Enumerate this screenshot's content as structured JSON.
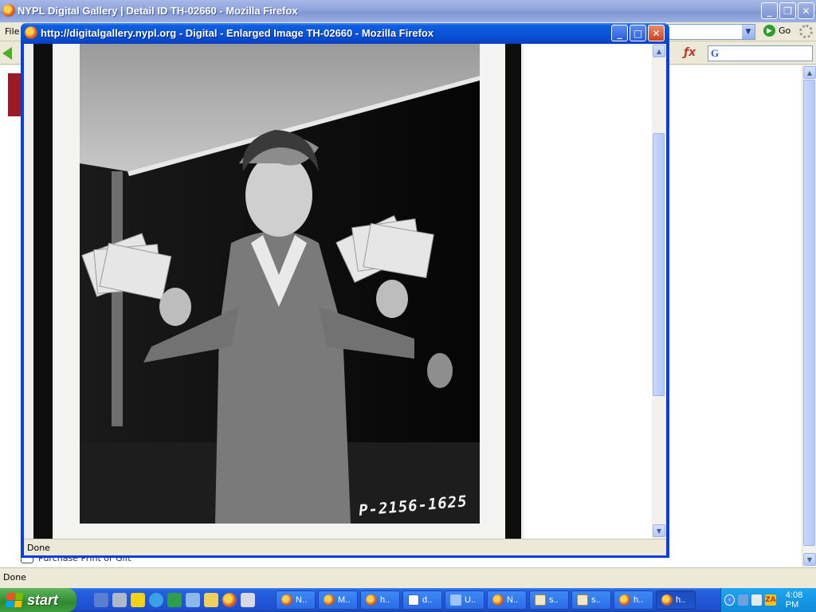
{
  "background_window": {
    "title": "NYPL Digital Gallery | Detail ID TH-02660 - Mozilla Firefox",
    "menu_file": "File",
    "go_label": "Go",
    "purchase_link": "Purchase Print or Gift",
    "status": "Done"
  },
  "popup_window": {
    "title": "http://digitalgallery.nypl.org - Digital - Enlarged Image TH-02660 - Mozilla Firefox",
    "photo_annotation": "P-2156-1625",
    "status": "Done"
  },
  "taskbar": {
    "start_label": "start",
    "tasks": [
      {
        "label": "N..",
        "icon": "firefox-icon"
      },
      {
        "label": "M..",
        "icon": "firefox-icon"
      },
      {
        "label": "h..",
        "icon": "firefox-icon"
      },
      {
        "label": "d..",
        "icon": "word-icon"
      },
      {
        "label": "U..",
        "icon": "document-icon"
      },
      {
        "label": "N..",
        "icon": "firefox-icon"
      },
      {
        "label": "s..",
        "icon": "spreadsheet-icon"
      },
      {
        "label": "s..",
        "icon": "spreadsheet-icon"
      },
      {
        "label": "h..",
        "icon": "firefox-icon"
      },
      {
        "label": "h..",
        "icon": "firefox-icon",
        "active": true
      }
    ],
    "tray_za": "ZA",
    "clock": "4:08 PM"
  }
}
